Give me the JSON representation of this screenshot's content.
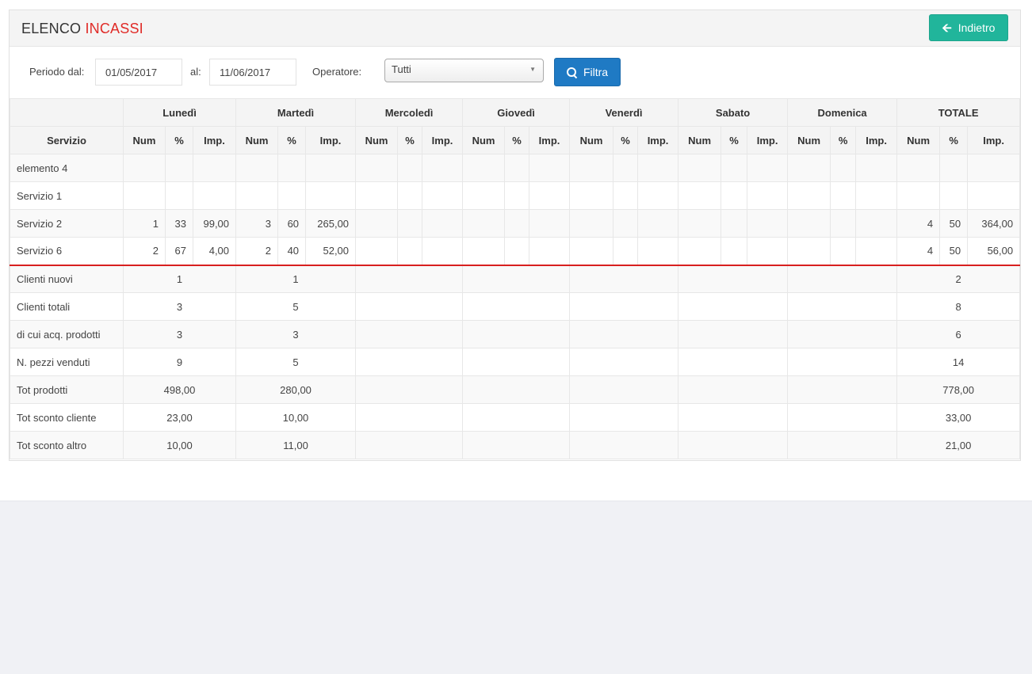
{
  "header": {
    "title_part1": "ELENCO",
    "title_part2": "INCASSI",
    "back_label": "Indietro",
    "accent_color": "#e02b27",
    "back_color": "#21b59b",
    "back_icon": "arrow-left-icon"
  },
  "filters": {
    "period_from_label": "Periodo dal:",
    "period_from_value": "01/05/2017",
    "period_to_label": "al:",
    "period_to_value": "11/06/2017",
    "operator_label": "Operatore:",
    "operator_value": "Tutti",
    "filter_label": "Filtra",
    "filter_color": "#1f7ac4",
    "filter_icon": "search-icon"
  },
  "table": {
    "day_headers": [
      "Lunedì",
      "Martedì",
      "Mercoledì",
      "Giovedì",
      "Venerdì",
      "Sabato",
      "Domenica",
      "TOTALE"
    ],
    "service_header": "Servizio",
    "sub_headers": [
      "Num",
      "%",
      "Imp."
    ],
    "service_rows": [
      {
        "name": "elemento 4",
        "cells": [
          "",
          "",
          "",
          "",
          "",
          "",
          "",
          "",
          "",
          "",
          "",
          "",
          "",
          "",
          "",
          "",
          "",
          "",
          "",
          "",
          "",
          "",
          "",
          ""
        ]
      },
      {
        "name": "Servizio 1",
        "cells": [
          "",
          "",
          "",
          "",
          "",
          "",
          "",
          "",
          "",
          "",
          "",
          "",
          "",
          "",
          "",
          "",
          "",
          "",
          "",
          "",
          "",
          "",
          "",
          ""
        ]
      },
      {
        "name": "Servizio 2",
        "cells": [
          "1",
          "33",
          "99,00",
          "3",
          "60",
          "265,00",
          "",
          "",
          "",
          "",
          "",
          "",
          "",
          "",
          "",
          "",
          "",
          "",
          "",
          "",
          "",
          "4",
          "50",
          "364,00"
        ]
      },
      {
        "name": "Servizio 6",
        "cells": [
          "2",
          "67",
          "4,00",
          "2",
          "40",
          "52,00",
          "",
          "",
          "",
          "",
          "",
          "",
          "",
          "",
          "",
          "",
          "",
          "",
          "",
          "",
          "",
          "4",
          "50",
          "56,00"
        ]
      }
    ],
    "summary_rows": [
      {
        "name": "Clienti nuovi",
        "cells": [
          "1",
          "1",
          "",
          "",
          "",
          "",
          "",
          "2"
        ]
      },
      {
        "name": "Clienti totali",
        "cells": [
          "3",
          "5",
          "",
          "",
          "",
          "",
          "",
          "8"
        ]
      },
      {
        "name": "di cui acq. prodotti",
        "cells": [
          "3",
          "3",
          "",
          "",
          "",
          "",
          "",
          "6"
        ]
      },
      {
        "name": "N. pezzi venduti",
        "cells": [
          "9",
          "5",
          "",
          "",
          "",
          "",
          "",
          "14"
        ]
      },
      {
        "name": "Tot prodotti",
        "cells": [
          "498,00",
          "280,00",
          "",
          "",
          "",
          "",
          "",
          "778,00"
        ]
      },
      {
        "name": "Tot sconto cliente",
        "cells": [
          "23,00",
          "10,00",
          "",
          "",
          "",
          "",
          "",
          "33,00"
        ]
      },
      {
        "name": "Tot sconto altro",
        "cells": [
          "10,00",
          "11,00",
          "",
          "",
          "",
          "",
          "",
          "21,00"
        ]
      }
    ]
  }
}
